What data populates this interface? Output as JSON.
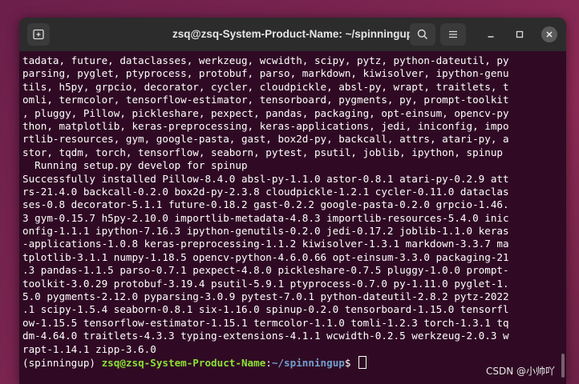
{
  "window": {
    "title": "zsq@zsq-System-Product-Name: ~/spinningup"
  },
  "icons": {
    "new_tab": "new-tab-icon",
    "search": "search-icon",
    "menu": "hamburger-menu-icon",
    "minimize": "minimize-icon",
    "maximize": "maximize-icon",
    "close": "close-icon"
  },
  "colors": {
    "terminal_bg": "#300a24",
    "titlebar_bg": "#2c2c2c",
    "prompt_user": "#8ae234",
    "prompt_path": "#729fcf",
    "desktop_bg": "#7a2450"
  },
  "terminal": {
    "lines": [
      "tadata, future, dataclasses, werkzeug, wcwidth, scipy, pytz, python-dateutil, py",
      "parsing, pyglet, ptyprocess, protobuf, parso, markdown, kiwisolver, ipython-genu",
      "tils, h5py, grpcio, decorator, cycler, cloudpickle, absl-py, wrapt, traitlets, t",
      "omli, termcolor, tensorflow-estimator, tensorboard, pygments, py, prompt-toolkit",
      ", pluggy, Pillow, pickleshare, pexpect, pandas, packaging, opt-einsum, opencv-py",
      "thon, matplotlib, keras-preprocessing, keras-applications, jedi, iniconfig, impo",
      "rtlib-resources, gym, google-pasta, gast, box2d-py, backcall, attrs, atari-py, a",
      "stor, tqdm, torch, tensorflow, seaborn, pytest, psutil, joblib, ipython, spinup",
      "  Running setup.py develop for spinup",
      "Successfully installed Pillow-8.4.0 absl-py-1.1.0 astor-0.8.1 atari-py-0.2.9 att",
      "rs-21.4.0 backcall-0.2.0 box2d-py-2.3.8 cloudpickle-1.2.1 cycler-0.11.0 dataclas",
      "ses-0.8 decorator-5.1.1 future-0.18.2 gast-0.2.2 google-pasta-0.2.0 grpcio-1.46.",
      "3 gym-0.15.7 h5py-2.10.0 importlib-metadata-4.8.3 importlib-resources-5.4.0 inic",
      "onfig-1.1.1 ipython-7.16.3 ipython-genutils-0.2.0 jedi-0.17.2 joblib-1.1.0 keras",
      "-applications-1.0.8 keras-preprocessing-1.1.2 kiwisolver-1.3.1 markdown-3.3.7 ma",
      "tplotlib-3.1.1 numpy-1.18.5 opencv-python-4.6.0.66 opt-einsum-3.3.0 packaging-21",
      ".3 pandas-1.1.5 parso-0.7.1 pexpect-4.8.0 pickleshare-0.7.5 pluggy-1.0.0 prompt-",
      "toolkit-3.0.29 protobuf-3.19.4 psutil-5.9.1 ptyprocess-0.7.0 py-1.11.0 pyglet-1.",
      "5.0 pygments-2.12.0 pyparsing-3.0.9 pytest-7.0.1 python-dateutil-2.8.2 pytz-2022",
      ".1 scipy-1.5.4 seaborn-0.8.1 six-1.16.0 spinup-0.2.0 tensorboard-1.15.0 tensorfl",
      "ow-1.15.5 tensorflow-estimator-1.15.1 termcolor-1.1.0 tomli-1.2.3 torch-1.3.1 tq",
      "dm-4.64.0 traitlets-4.3.3 typing-extensions-4.1.1 wcwidth-0.2.5 werkzeug-2.0.3 w",
      "rapt-1.14.1 zipp-3.6.0"
    ],
    "prompt": {
      "env": "(spinningup) ",
      "user_host": "zsq@zsq-System-Product-Name",
      "separator": ":",
      "path": "~/spinningup",
      "symbol": "$ "
    }
  },
  "watermark": "CSDN @小帅吖"
}
